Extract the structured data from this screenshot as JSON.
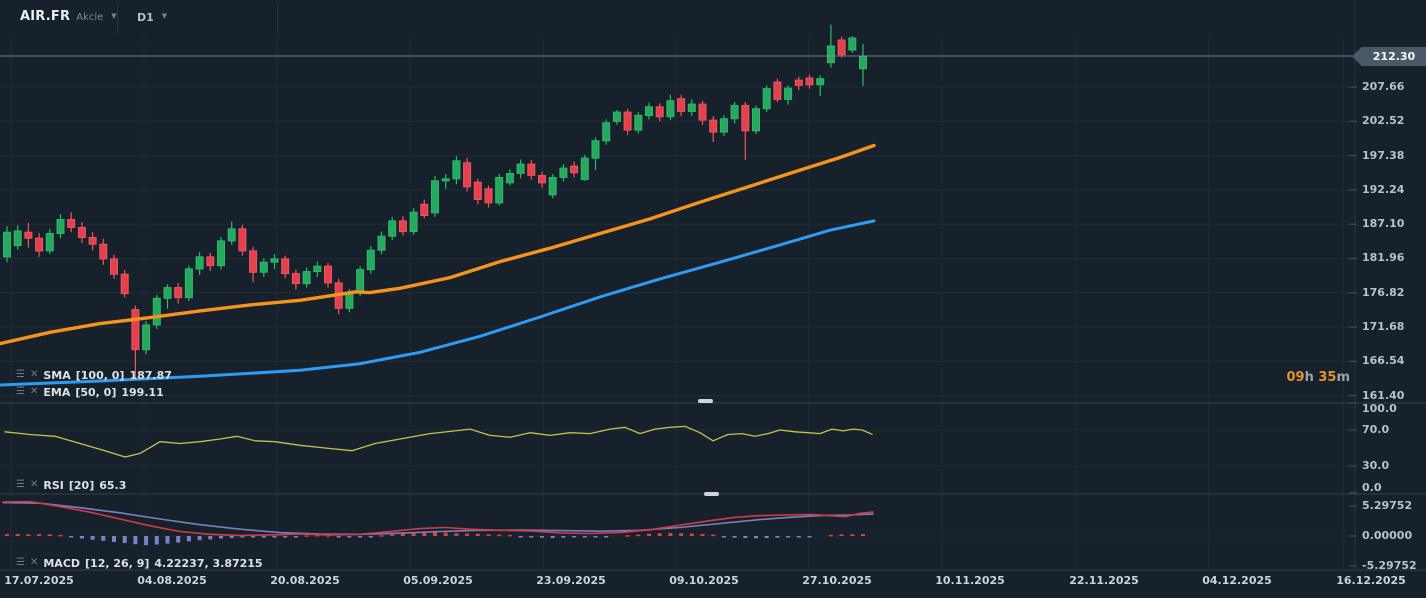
{
  "header": {
    "symbol": "AIR.FR",
    "instrument_type": "Akcie",
    "timeframe": "D1"
  },
  "session_countdown": {
    "hours": "09",
    "hours_unit": "h",
    "minutes": "35",
    "minutes_unit": "m"
  },
  "price_axis": {
    "current_price": "212.30",
    "tick_labels": [
      "207.66",
      "202.52",
      "197.38",
      "192.24",
      "187.10",
      "181.96",
      "176.82",
      "171.68",
      "166.54",
      "161.40"
    ]
  },
  "rsi_axis": {
    "labels": [
      "100.0",
      "70.0",
      "30.0",
      "0.0"
    ]
  },
  "macd_axis": {
    "labels": [
      "5.29752",
      "0.00000",
      "-5.29752"
    ]
  },
  "time_axis": {
    "labels": [
      "17.07.2025",
      "04.08.2025",
      "20.08.2025",
      "05.09.2025",
      "23.09.2025",
      "09.10.2025",
      "27.10.2025",
      "10.11.2025",
      "22.11.2025",
      "04.12.2025",
      "16.12.2025"
    ]
  },
  "indicators": {
    "sma": {
      "name": "SMA",
      "params": "[100, 0]",
      "value": "187.87",
      "color": "#2d9cf4"
    },
    "ema": {
      "name": "EMA",
      "params": "[50, 0]",
      "value": "199.11",
      "color": "#f6921e"
    },
    "rsi": {
      "name": "RSI",
      "params": "[20]",
      "value": "65.3",
      "color": "#c5c14f"
    },
    "macd": {
      "name": "MACD",
      "params": "[12, 26, 9]",
      "value": "4.22237,  3.87215",
      "line_color": "#d23c46",
      "signal_color": "#7a80be"
    }
  },
  "colors": {
    "background": "#17212b",
    "grid": "#202c36",
    "candle_up": "#26a85e",
    "candle_up_border": "#2db96a",
    "candle_down": "#e2414d",
    "candle_down_border": "#ee5560",
    "ema_line": "#f6921e",
    "sma_line": "#2d9cf4",
    "rsi_line": "#c5c14f",
    "macd_line": "#d23c46",
    "macd_signal": "#7a80be",
    "hist_positive": "#df413c",
    "hist_negative": "#7b82c8",
    "price_line": "#8d99a3",
    "badge_bg": "#4b5967",
    "countdown_accent": "#e8922e"
  },
  "chart_data": {
    "type": "candlestick",
    "title": "AIR.FR Akcie D1",
    "main_panel": {
      "ylim": [
        159,
        218
      ],
      "tick_interval": 5.14,
      "grid": true
    },
    "candles_ohlc": [
      [
        182.2,
        186.8,
        181.4,
        185.9
      ],
      [
        183.9,
        186.9,
        183.3,
        186.1
      ],
      [
        185.9,
        187.3,
        183.6,
        185.0
      ],
      [
        185.0,
        185.8,
        182.2,
        183.1
      ],
      [
        183.1,
        186.4,
        182.6,
        185.7
      ],
      [
        185.7,
        188.6,
        185.0,
        187.8
      ],
      [
        187.8,
        188.9,
        185.9,
        186.6
      ],
      [
        186.6,
        187.4,
        184.3,
        185.1
      ],
      [
        185.1,
        185.9,
        183.2,
        184.1
      ],
      [
        184.1,
        184.9,
        181.0,
        181.9
      ],
      [
        181.9,
        182.5,
        178.9,
        179.6
      ],
      [
        179.6,
        180.2,
        176.1,
        176.7
      ],
      [
        174.3,
        174.9,
        163.8,
        168.3
      ],
      [
        168.3,
        172.6,
        167.6,
        172.0
      ],
      [
        172.0,
        176.5,
        171.4,
        176.0
      ],
      [
        176.0,
        178.1,
        174.4,
        177.6
      ],
      [
        177.6,
        178.3,
        175.2,
        176.1
      ],
      [
        176.1,
        180.9,
        175.6,
        180.4
      ],
      [
        180.4,
        182.9,
        179.5,
        182.2
      ],
      [
        182.2,
        182.8,
        180.1,
        180.9
      ],
      [
        180.9,
        185.2,
        180.3,
        184.6
      ],
      [
        184.6,
        187.5,
        184.0,
        186.4
      ],
      [
        186.4,
        187.0,
        182.4,
        183.1
      ],
      [
        183.1,
        183.7,
        178.4,
        179.9
      ],
      [
        179.9,
        182.0,
        179.2,
        181.4
      ],
      [
        181.4,
        182.6,
        180.4,
        181.9
      ],
      [
        181.9,
        182.4,
        179.0,
        179.7
      ],
      [
        179.7,
        180.3,
        177.3,
        178.2
      ],
      [
        178.2,
        180.6,
        177.6,
        180.0
      ],
      [
        180.0,
        181.5,
        179.2,
        180.8
      ],
      [
        180.8,
        181.3,
        177.6,
        178.3
      ],
      [
        178.3,
        178.9,
        173.6,
        174.5
      ],
      [
        174.5,
        177.4,
        173.9,
        176.9
      ],
      [
        176.9,
        180.8,
        176.3,
        180.3
      ],
      [
        180.3,
        183.8,
        179.7,
        183.2
      ],
      [
        183.2,
        186.0,
        182.6,
        185.3
      ],
      [
        185.3,
        188.2,
        184.7,
        187.6
      ],
      [
        187.6,
        188.3,
        185.4,
        186.0
      ],
      [
        186.0,
        189.5,
        185.5,
        188.9
      ],
      [
        190.1,
        190.8,
        188.0,
        188.4
      ],
      [
        188.8,
        194.3,
        188.2,
        193.6
      ],
      [
        193.6,
        194.6,
        192.4,
        193.9
      ],
      [
        193.9,
        197.3,
        193.1,
        196.6
      ],
      [
        196.3,
        197.0,
        192.0,
        192.7
      ],
      [
        193.4,
        193.9,
        190.1,
        190.8
      ],
      [
        192.4,
        192.9,
        189.6,
        190.3
      ],
      [
        190.3,
        194.6,
        189.9,
        194.1
      ],
      [
        193.3,
        195.3,
        192.9,
        194.7
      ],
      [
        194.7,
        196.8,
        194.0,
        196.1
      ],
      [
        196.1,
        196.7,
        193.8,
        194.4
      ],
      [
        194.4,
        195.0,
        192.6,
        193.3
      ],
      [
        191.5,
        194.6,
        191.0,
        194.1
      ],
      [
        194.1,
        196.1,
        193.5,
        195.5
      ],
      [
        195.8,
        196.5,
        194.1,
        194.8
      ],
      [
        193.8,
        197.5,
        193.6,
        197.0
      ],
      [
        197.0,
        200.1,
        195.2,
        199.6
      ],
      [
        199.6,
        202.8,
        199.0,
        202.3
      ],
      [
        202.5,
        204.2,
        202.0,
        203.9
      ],
      [
        203.9,
        204.4,
        200.5,
        201.2
      ],
      [
        201.2,
        203.9,
        200.7,
        203.4
      ],
      [
        203.4,
        205.3,
        202.8,
        204.7
      ],
      [
        204.7,
        205.2,
        202.5,
        203.2
      ],
      [
        203.2,
        206.5,
        202.7,
        205.6
      ],
      [
        205.9,
        206.5,
        203.3,
        204.0
      ],
      [
        204.0,
        205.8,
        203.3,
        205.1
      ],
      [
        205.1,
        205.6,
        202.0,
        202.7
      ],
      [
        202.7,
        203.3,
        199.4,
        200.9
      ],
      [
        200.9,
        203.4,
        200.3,
        202.9
      ],
      [
        202.9,
        205.4,
        202.2,
        204.9
      ],
      [
        204.9,
        205.4,
        196.7,
        201.1
      ],
      [
        201.1,
        204.9,
        200.6,
        204.4
      ],
      [
        204.4,
        207.9,
        203.9,
        207.4
      ],
      [
        208.4,
        208.9,
        205.4,
        205.8
      ],
      [
        205.8,
        207.9,
        205.0,
        207.5
      ],
      [
        208.7,
        209.2,
        207.2,
        207.9
      ],
      [
        209.0,
        209.5,
        207.4,
        208.0
      ],
      [
        208.0,
        209.4,
        206.3,
        208.9
      ],
      [
        211.3,
        217.0,
        210.6,
        213.8
      ],
      [
        214.7,
        215.2,
        212.1,
        212.5
      ],
      [
        213.2,
        215.3,
        212.8,
        215.0
      ],
      [
        210.4,
        214.1,
        207.8,
        212.3
      ]
    ],
    "overlays": {
      "ema50": {
        "label": "EMA [50, 0]",
        "last": 199.11,
        "points": [
          [
            0,
            169.2
          ],
          [
            50,
            170.9
          ],
          [
            100,
            172.2
          ],
          [
            150,
            173.1
          ],
          [
            200,
            174.1
          ],
          [
            250,
            175.0
          ],
          [
            300,
            175.7
          ],
          [
            340,
            176.6
          ],
          [
            355,
            176.95
          ],
          [
            370,
            176.85
          ],
          [
            400,
            177.5
          ],
          [
            450,
            179.1
          ],
          [
            500,
            181.5
          ],
          [
            550,
            183.5
          ],
          [
            600,
            185.7
          ],
          [
            650,
            187.9
          ],
          [
            700,
            190.4
          ],
          [
            750,
            192.8
          ],
          [
            800,
            195.2
          ],
          [
            840,
            197.1
          ],
          [
            874,
            198.9
          ]
        ]
      },
      "sma100": {
        "label": "SMA [100, 0]",
        "last": 187.87,
        "points": [
          [
            0,
            163.0
          ],
          [
            100,
            163.6
          ],
          [
            200,
            164.3
          ],
          [
            300,
            165.2
          ],
          [
            360,
            166.2
          ],
          [
            420,
            167.9
          ],
          [
            480,
            170.3
          ],
          [
            540,
            173.2
          ],
          [
            600,
            176.2
          ],
          [
            660,
            178.9
          ],
          [
            720,
            181.4
          ],
          [
            780,
            184.0
          ],
          [
            830,
            186.2
          ],
          [
            874,
            187.6
          ]
        ]
      }
    },
    "rsi": {
      "period": 20,
      "last": 65.3,
      "ylim": [
        0,
        100
      ],
      "bands": [
        70,
        30
      ],
      "points": [
        [
          5,
          68
        ],
        [
          30,
          65
        ],
        [
          55,
          63
        ],
        [
          80,
          55
        ],
        [
          105,
          47
        ],
        [
          125,
          40
        ],
        [
          140,
          44
        ],
        [
          160,
          57
        ],
        [
          180,
          55
        ],
        [
          200,
          57
        ],
        [
          220,
          60
        ],
        [
          237,
          63
        ],
        [
          255,
          58
        ],
        [
          275,
          57
        ],
        [
          300,
          53
        ],
        [
          325,
          50
        ],
        [
          352,
          47
        ],
        [
          375,
          55
        ],
        [
          400,
          60
        ],
        [
          430,
          66
        ],
        [
          455,
          69
        ],
        [
          470,
          71
        ],
        [
          490,
          64
        ],
        [
          510,
          62
        ],
        [
          530,
          67
        ],
        [
          550,
          64
        ],
        [
          570,
          67
        ],
        [
          590,
          66
        ],
        [
          610,
          71
        ],
        [
          625,
          73
        ],
        [
          640,
          66
        ],
        [
          655,
          71
        ],
        [
          670,
          73
        ],
        [
          685,
          74
        ],
        [
          700,
          67
        ],
        [
          713,
          58
        ],
        [
          728,
          65
        ],
        [
          742,
          66
        ],
        [
          755,
          63
        ],
        [
          768,
          66
        ],
        [
          780,
          70
        ],
        [
          795,
          68
        ],
        [
          808,
          67
        ],
        [
          820,
          66
        ],
        [
          832,
          71
        ],
        [
          843,
          69
        ],
        [
          853,
          71
        ],
        [
          862,
          70
        ],
        [
          872,
          65.3
        ]
      ]
    },
    "macd": {
      "fast": 12,
      "slow": 26,
      "signal_period": 9,
      "last_macd": 4.22237,
      "last_signal": 3.87215,
      "ylim": [
        -5.29752,
        5.29752
      ],
      "macd_line": [
        [
          3,
          6.0
        ],
        [
          30,
          6.1
        ],
        [
          60,
          5.2
        ],
        [
          90,
          4.2
        ],
        [
          120,
          3.0
        ],
        [
          150,
          1.8
        ],
        [
          180,
          0.8
        ],
        [
          210,
          0.3
        ],
        [
          240,
          0.1
        ],
        [
          270,
          0.2
        ],
        [
          300,
          0.35
        ],
        [
          330,
          0.2
        ],
        [
          360,
          0.3
        ],
        [
          390,
          0.8
        ],
        [
          420,
          1.3
        ],
        [
          445,
          1.5
        ],
        [
          470,
          1.2
        ],
        [
          500,
          1.0
        ],
        [
          530,
          0.9
        ],
        [
          560,
          0.55
        ],
        [
          590,
          0.45
        ],
        [
          620,
          0.6
        ],
        [
          650,
          1.1
        ],
        [
          680,
          1.9
        ],
        [
          710,
          2.7
        ],
        [
          735,
          3.3
        ],
        [
          760,
          3.6
        ],
        [
          785,
          3.7
        ],
        [
          810,
          3.8
        ],
        [
          830,
          3.6
        ],
        [
          845,
          3.4
        ],
        [
          860,
          4.0
        ],
        [
          873,
          4.22
        ]
      ],
      "signal_line": [
        [
          3,
          5.9
        ],
        [
          40,
          5.8
        ],
        [
          80,
          5.0
        ],
        [
          120,
          4.1
        ],
        [
          160,
          3.0
        ],
        [
          200,
          2.0
        ],
        [
          240,
          1.2
        ],
        [
          280,
          0.6
        ],
        [
          320,
          0.35
        ],
        [
          360,
          0.3
        ],
        [
          400,
          0.5
        ],
        [
          440,
          0.8
        ],
        [
          480,
          1.0
        ],
        [
          520,
          1.05
        ],
        [
          560,
          0.95
        ],
        [
          600,
          0.85
        ],
        [
          640,
          1.0
        ],
        [
          680,
          1.5
        ],
        [
          720,
          2.2
        ],
        [
          760,
          2.9
        ],
        [
          790,
          3.3
        ],
        [
          820,
          3.6
        ],
        [
          850,
          3.7
        ],
        [
          873,
          3.87
        ]
      ],
      "histogram": [
        0.3,
        0.35,
        0.3,
        0.35,
        0.3,
        0.2,
        -0.25,
        -0.45,
        -0.65,
        -0.85,
        -1.05,
        -1.25,
        -1.45,
        -1.6,
        -1.5,
        -1.35,
        -1.15,
        -0.95,
        -0.75,
        -0.6,
        -0.45,
        -0.35,
        -0.25,
        -0.2,
        -0.15,
        -0.12,
        -0.12,
        -0.15,
        0.12,
        0.18,
        0.15,
        -0.12,
        -0.18,
        -0.15,
        -0.12,
        0.15,
        0.3,
        0.5,
        0.65,
        0.75,
        0.7,
        0.6,
        0.5,
        0.45,
        0.4,
        0.3,
        0.25,
        0.2,
        -0.15,
        -0.2,
        -0.3,
        -0.35,
        -0.3,
        -0.25,
        -0.2,
        -0.15,
        -0.1,
        0,
        0.15,
        0.25,
        0.4,
        0.5,
        0.55,
        0.5,
        0.45,
        0.35,
        0.25,
        -0.2,
        -0.3,
        -0.35,
        -0.4,
        -0.35,
        -0.3,
        -0.25,
        -0.2,
        -0.15,
        0,
        0.2,
        0.3,
        0.3,
        0.35
      ]
    }
  }
}
